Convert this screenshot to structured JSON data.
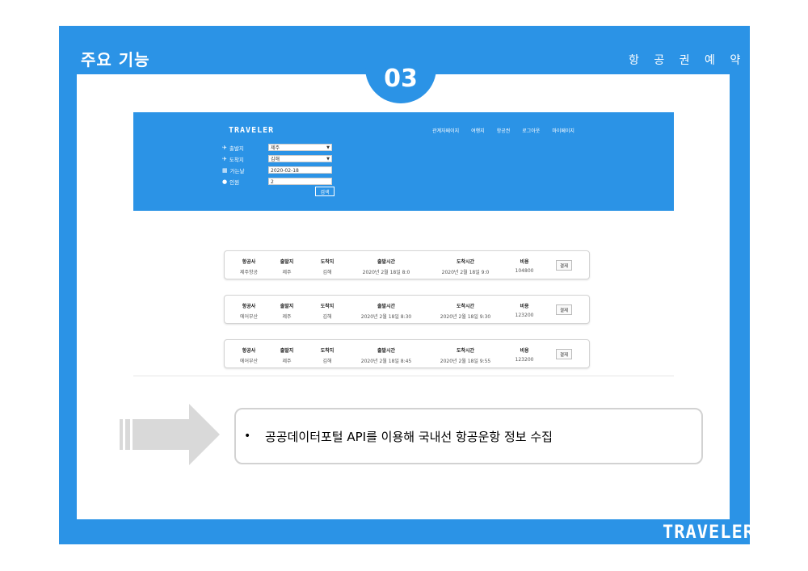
{
  "slide": {
    "title": "주요 기능",
    "subtitle": "항 공 권  예 약",
    "number": "03",
    "footer_logo": "TRAVELER"
  },
  "site": {
    "logo": "TRAVELER",
    "nav": [
      "관계자페이지",
      "여행지",
      "항공권",
      "로그아웃",
      "마이페이지"
    ],
    "form": {
      "departure": {
        "label": "출발지",
        "icon": "plane-takeoff-icon",
        "value": "제주"
      },
      "arrival": {
        "label": "도착지",
        "icon": "plane-landing-icon",
        "value": "김해"
      },
      "date": {
        "label": "가는날",
        "icon": "calendar-icon",
        "value": "2020-02-18"
      },
      "people": {
        "label": "인원",
        "icon": "person-icon",
        "value": "2"
      },
      "search_button": "검색"
    }
  },
  "results": {
    "headers": [
      "항공사",
      "출발지",
      "도착지",
      "출발시간",
      "도착시간",
      "비용"
    ],
    "rows": [
      {
        "airline": "제주항공",
        "from": "제주",
        "to": "김해",
        "dep": "2020년 2월 18일 8:0",
        "arr": "2020년 2월 18일 9:0",
        "price": "104800",
        "button": "결제"
      },
      {
        "airline": "에어부산",
        "from": "제주",
        "to": "김해",
        "dep": "2020년 2월 18일 8:30",
        "arr": "2020년 2월 18일 9:30",
        "price": "123200",
        "button": "결제"
      },
      {
        "airline": "에어부산",
        "from": "제주",
        "to": "김해",
        "dep": "2020년 2월 18일 8:45",
        "arr": "2020년 2월 18일 9:55",
        "price": "123200",
        "button": "결제"
      }
    ]
  },
  "callout": {
    "bullet": "•",
    "text": "공공데이터포털 API를 이용해 국내선 항공운항 정보 수집"
  },
  "colors": {
    "brand_blue": "#2b93e6",
    "arrow_gray": "#d9d9d9"
  }
}
